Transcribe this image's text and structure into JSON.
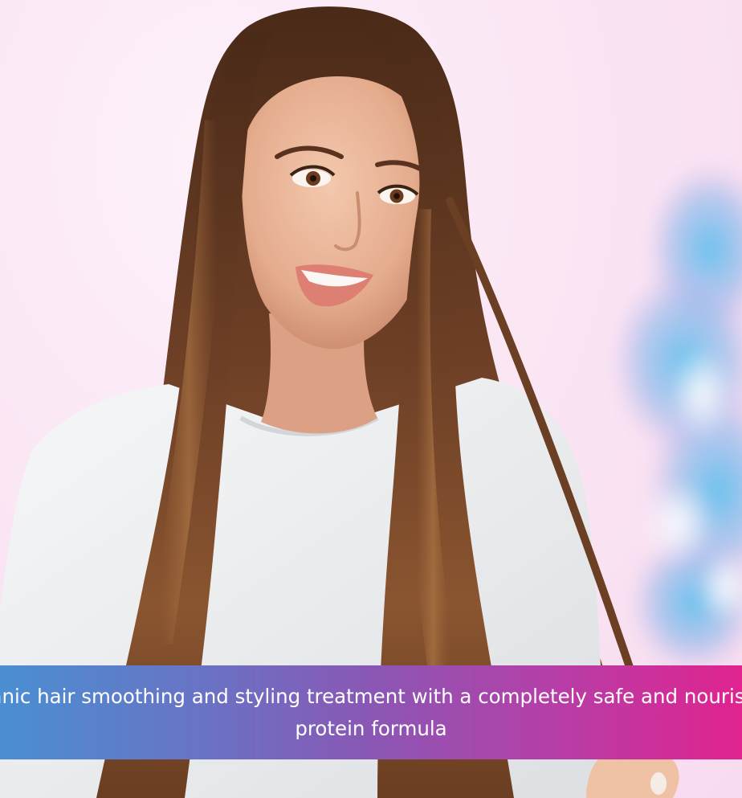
{
  "banner": {
    "caption": "Organic hair smoothing and styling treatment with a completely safe and nourishing protein formula"
  },
  "colors": {
    "background": "#fbe6f4",
    "caption_gradient_start": "#4a8fd2",
    "caption_gradient_mid": "#8a57b4",
    "caption_gradient_end": "#e0238f",
    "caption_text": "#ffffff",
    "hair": "#5a3520",
    "shirt": "#eef0f1",
    "skin": "#e7b397"
  },
  "images": {
    "hero_photo": "woman-long-straight-hair-photo",
    "smoke": "blue-ink-cloud"
  }
}
